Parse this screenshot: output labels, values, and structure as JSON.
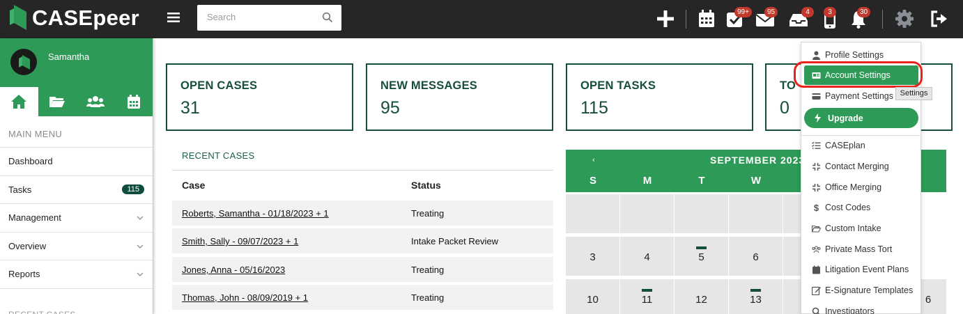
{
  "app": {
    "name": "CASEpeer",
    "search_placeholder": "Search",
    "colors": {
      "topbar": "#262626",
      "primary": "#2e9a57",
      "dark_green": "#164e3c",
      "badge": "#c0392b",
      "highlight": "#e8231a"
    }
  },
  "topbar": {
    "icons": [
      "plus-icon",
      "calendar-icon",
      "task-check-icon",
      "mail-icon",
      "inbox-icon",
      "phone-icon",
      "bell-icon",
      "gear-icon",
      "logout-icon"
    ],
    "badges": {
      "tasks": "99+",
      "mail": "95",
      "inbox": "4",
      "phone": "3",
      "bell": "30"
    }
  },
  "sidebar": {
    "user_name": "Samantha",
    "tabs": [
      "home-icon",
      "folder-icon",
      "users-icon",
      "calendar-icon"
    ],
    "main_menu_heading": "MAIN MENU",
    "items": [
      {
        "label": "Dashboard"
      },
      {
        "label": "Tasks",
        "count": "115"
      },
      {
        "label": "Management"
      },
      {
        "label": "Overview"
      },
      {
        "label": "Reports"
      }
    ],
    "recent_heading": "RECENT CASES"
  },
  "cards": [
    {
      "label": "OPEN CASES",
      "value": "31"
    },
    {
      "label": "NEW MESSAGES",
      "value": "95"
    },
    {
      "label": "OPEN TASKS",
      "value": "115"
    },
    {
      "label": "TO",
      "value": "0"
    }
  ],
  "recent_cases": {
    "title": "RECENT CASES",
    "columns": [
      "Case",
      "Status"
    ],
    "rows": [
      {
        "case": "Roberts, Samantha - 01/18/2023 + 1",
        "status": "Treating"
      },
      {
        "case": "Smith, Sally - 09/07/2023 + 1",
        "status": "Intake Packet Review"
      },
      {
        "case": "Jones, Anna - 05/16/2023",
        "status": "Treating"
      },
      {
        "case": "Thomas, John - 08/09/2019 + 1",
        "status": "Treating"
      }
    ]
  },
  "calendar": {
    "prev": "‹",
    "month_title": "SEPTEMBER 2023",
    "weekdays": [
      "S",
      "M",
      "T",
      "W"
    ],
    "weeks": [
      [
        "",
        "",
        "",
        ""
      ],
      [
        "3",
        "4",
        "5",
        "6"
      ],
      [
        "10",
        "11",
        "12",
        "13"
      ]
    ],
    "peek": "6"
  },
  "settings_menu": {
    "items": [
      {
        "label": "Profile Settings",
        "icon": "user-icon"
      },
      {
        "label": "Account Settings",
        "icon": "id-card-icon"
      },
      {
        "label": "Payment Settings",
        "icon": "credit-card-icon"
      },
      {
        "label": "Upgrade",
        "icon": "bolt-icon"
      },
      {
        "label": "CASEplan",
        "icon": "checklist-icon"
      },
      {
        "label": "Contact Merging",
        "icon": "merge-icon"
      },
      {
        "label": "Office Merging",
        "icon": "merge-icon"
      },
      {
        "label": "Cost Codes",
        "icon": "dollar-icon"
      },
      {
        "label": "Custom Intake",
        "icon": "folder-open-icon"
      },
      {
        "label": "Private Mass Tort",
        "icon": "users-icon"
      },
      {
        "label": "Litigation Event Plans",
        "icon": "calendar-icon"
      },
      {
        "label": "E-Signature Templates",
        "icon": "edit-icon"
      },
      {
        "label": "Investigators",
        "icon": "search-icon"
      }
    ],
    "tooltip": "Settings"
  }
}
